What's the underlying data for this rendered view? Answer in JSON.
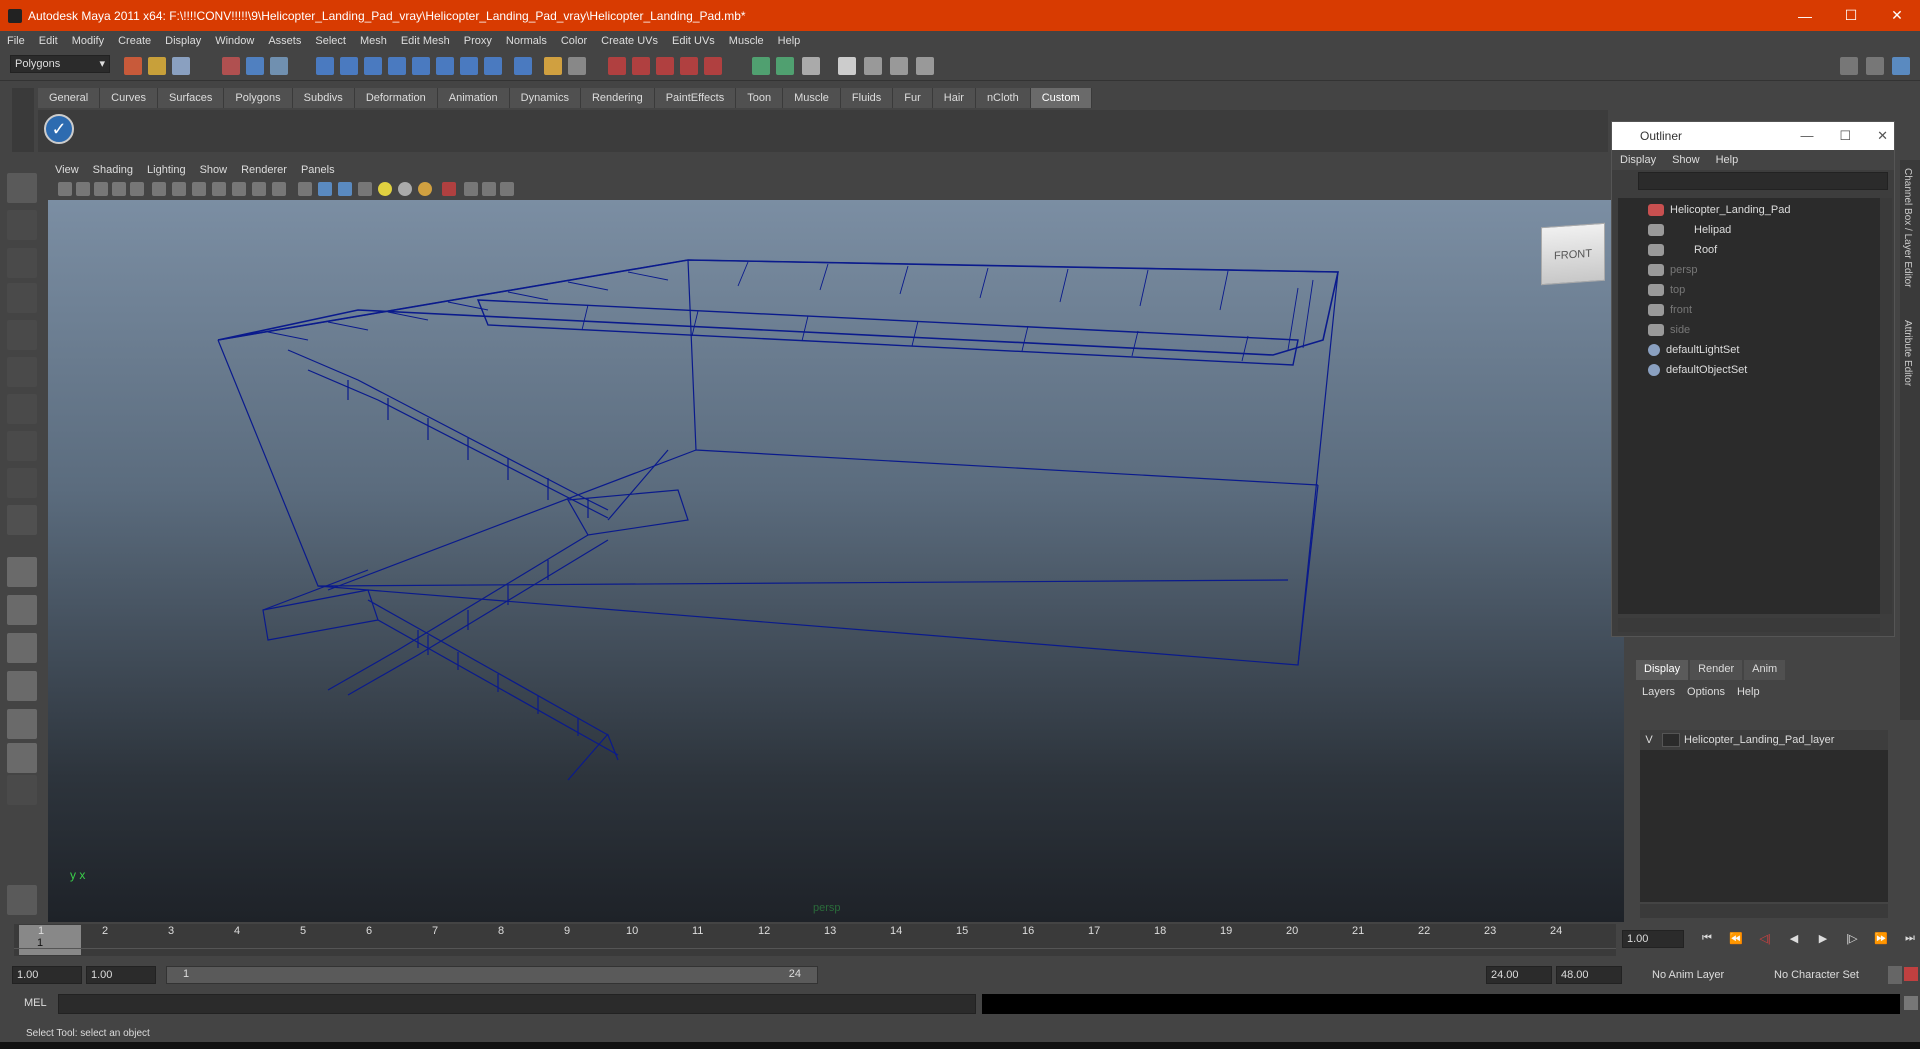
{
  "window": {
    "title": "Autodesk Maya 2011 x64: F:\\!!!!CONV!!!!!\\9\\Helicopter_Landing_Pad_vray\\Helicopter_Landing_Pad_vray\\Helicopter_Landing_Pad.mb*",
    "minimize": "—",
    "maximize": "☐",
    "close": "✕"
  },
  "menu": [
    "File",
    "Edit",
    "Modify",
    "Create",
    "Display",
    "Window",
    "Assets",
    "Select",
    "Mesh",
    "Edit Mesh",
    "Proxy",
    "Normals",
    "Color",
    "Create UVs",
    "Edit UVs",
    "Muscle",
    "Help"
  ],
  "status_line": {
    "mode": "Polygons"
  },
  "shelf": {
    "tabs": [
      "General",
      "Curves",
      "Surfaces",
      "Polygons",
      "Subdivs",
      "Deformation",
      "Animation",
      "Dynamics",
      "Rendering",
      "PaintEffects",
      "Toon",
      "Muscle",
      "Fluids",
      "Fur",
      "Hair",
      "nCloth",
      "Custom"
    ],
    "active": "Custom",
    "check_glyph": "✓"
  },
  "panel_menu": [
    "View",
    "Shading",
    "Lighting",
    "Show",
    "Renderer",
    "Panels"
  ],
  "viewport": {
    "camera_label": "persp",
    "view_cube_label": "FRONT",
    "axis_label": "y x"
  },
  "outliner": {
    "title": "Outliner",
    "menu": [
      "Display",
      "Show",
      "Help"
    ],
    "items": [
      {
        "label": "Helicopter_Landing_Pad",
        "dim": false
      },
      {
        "label": "Helipad",
        "dim": false
      },
      {
        "label": "Roof",
        "dim": false
      },
      {
        "label": "persp",
        "dim": true
      },
      {
        "label": "top",
        "dim": true
      },
      {
        "label": "front",
        "dim": true
      },
      {
        "label": "side",
        "dim": true
      },
      {
        "label": "defaultLightSet",
        "dim": false
      },
      {
        "label": "defaultObjectSet",
        "dim": false
      }
    ]
  },
  "side_tabs": {
    "channel_box": "Channel Box / Layer Editor",
    "attribute_editor": "Attribute Editor"
  },
  "layer_editor": {
    "tabs": [
      "Display",
      "Render",
      "Anim"
    ],
    "menu": [
      "Layers",
      "Options",
      "Help"
    ],
    "layers": [
      {
        "visible": "V",
        "name": "Helicopter_Landing_Pad_layer"
      }
    ]
  },
  "time_slider": {
    "current_frame": "1",
    "ticks": [
      "1",
      "2",
      "3",
      "4",
      "5",
      "6",
      "7",
      "8",
      "9",
      "10",
      "11",
      "12",
      "13",
      "14",
      "15",
      "16",
      "17",
      "18",
      "19",
      "20",
      "21",
      "22",
      "23",
      "24"
    ],
    "current_time_field": "1.00"
  },
  "range_slider": {
    "start": "1.00",
    "playback_start": "1.00",
    "range_min": "1",
    "range_max": "24",
    "playback_end": "24.00",
    "end": "48.00",
    "anim_layer": "No Anim Layer",
    "character_set": "No Character Set"
  },
  "command_line": {
    "label": "MEL"
  },
  "help_line": {
    "text": "Select Tool: select an object"
  },
  "colors": {
    "titlebar": "#d83b01",
    "wireframe": "#0a1a8c"
  }
}
